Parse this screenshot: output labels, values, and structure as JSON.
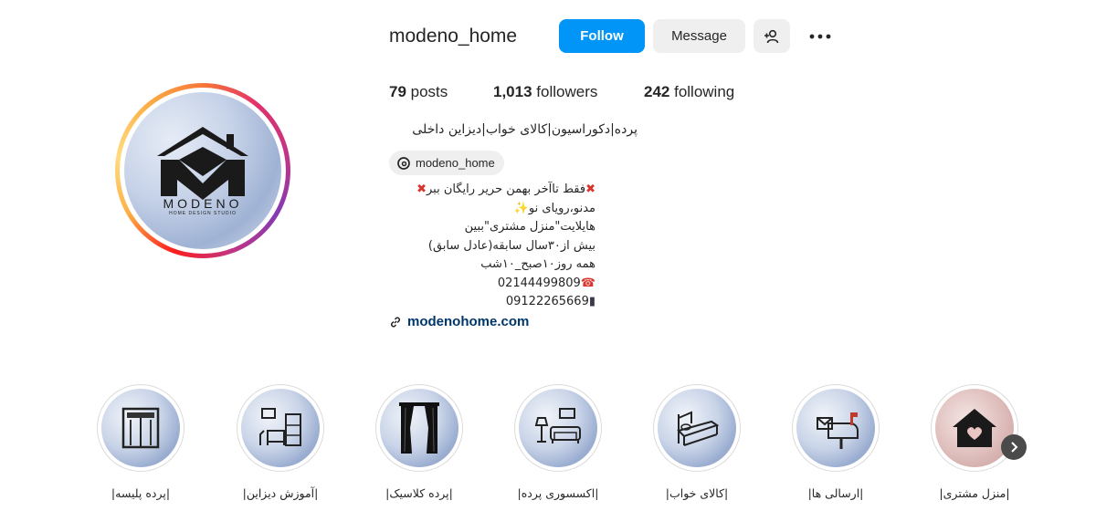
{
  "profile": {
    "username": "modeno_home",
    "avatar_logo_text": "MODENO",
    "avatar_logo_subtext": "HOME DESIGN STUDIO"
  },
  "actions": {
    "follow_label": "Follow",
    "message_label": "Message",
    "add_user_icon": "add-user-icon",
    "more_icon": "more-horizontal-icon"
  },
  "stats": {
    "posts_count": "79",
    "posts_label": " posts",
    "followers_count": "1,013",
    "followers_label": " followers",
    "following_count": "242",
    "following_label": " following"
  },
  "bio": {
    "title": "پرده|دکوراسیون|کالای خواب|دیزاین داخلی",
    "threads_handle": "modeno_home",
    "line1": "فقط تاآخر بهمن حریر رایگان ببر",
    "line2": "مدنو،رویای نو",
    "line3": "هایلایت\"منزل مشتری\"ببین",
    "line4": "بیش از۳۰سال سابقه(عادل سابق)",
    "line5": "همه روز۱۰صبح_۱۰شب",
    "line6": "02144499809",
    "line7": "09122265669",
    "link": "modenohome.com"
  },
  "highlights": [
    {
      "label": "|پرده پلیسه|",
      "icon": "blind-window-icon"
    },
    {
      "label": "|آموزش دیزاین|",
      "icon": "interior-room-icon"
    },
    {
      "label": "|پرده کلاسیک|",
      "icon": "classic-curtain-icon"
    },
    {
      "label": "|اکسسوری پرده|",
      "icon": "sofa-lamp-icon"
    },
    {
      "label": "|کالای خواب|",
      "icon": "bed-icon"
    },
    {
      "label": "|ارسالی ها|",
      "icon": "mailbox-icon"
    },
    {
      "label": "|منزل مشتری|",
      "icon": "home-heart-icon"
    }
  ],
  "colors": {
    "follow_button": "#0095f6",
    "secondary_button": "#efefef",
    "link": "#00376b"
  }
}
